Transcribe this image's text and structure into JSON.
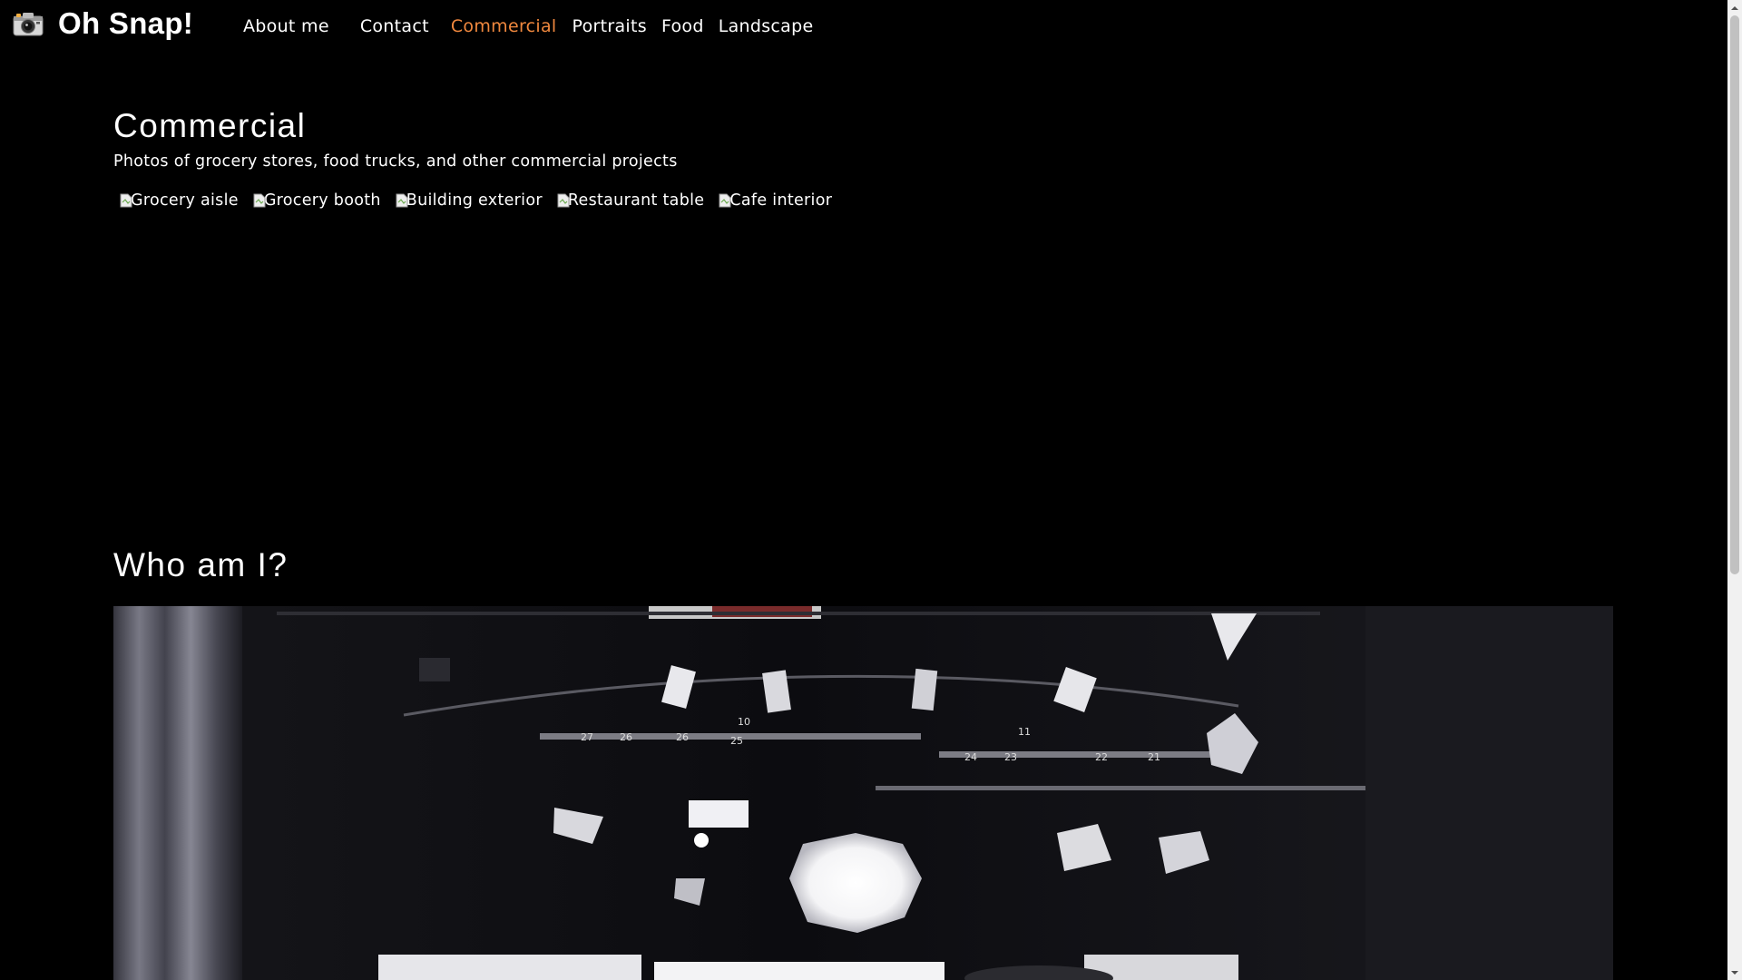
{
  "brand": {
    "name": "Oh Snap!",
    "icon": "camera-icon"
  },
  "nav": {
    "items": [
      {
        "label": "About me"
      },
      {
        "label": "Contact"
      },
      {
        "label": "Commercial",
        "active": true
      },
      {
        "label": "Portraits"
      },
      {
        "label": "Food"
      },
      {
        "label": "Landscape"
      }
    ],
    "active_color": "#f0883e"
  },
  "commercial": {
    "title": "Commercial",
    "subtitle": "Photos of grocery stores, food trucks, and other commercial projects",
    "images": [
      {
        "alt": "Grocery aisle"
      },
      {
        "alt": "Grocery booth"
      },
      {
        "alt": "Building exterior"
      },
      {
        "alt": "Restaurant table"
      },
      {
        "alt": "Cafe interior"
      }
    ]
  },
  "about": {
    "title": "Who am I?",
    "hero_image": "photo-studio-lighting-rig"
  },
  "colors": {
    "background": "#000000",
    "text": "#ffffff",
    "accent": "#f0883e"
  }
}
